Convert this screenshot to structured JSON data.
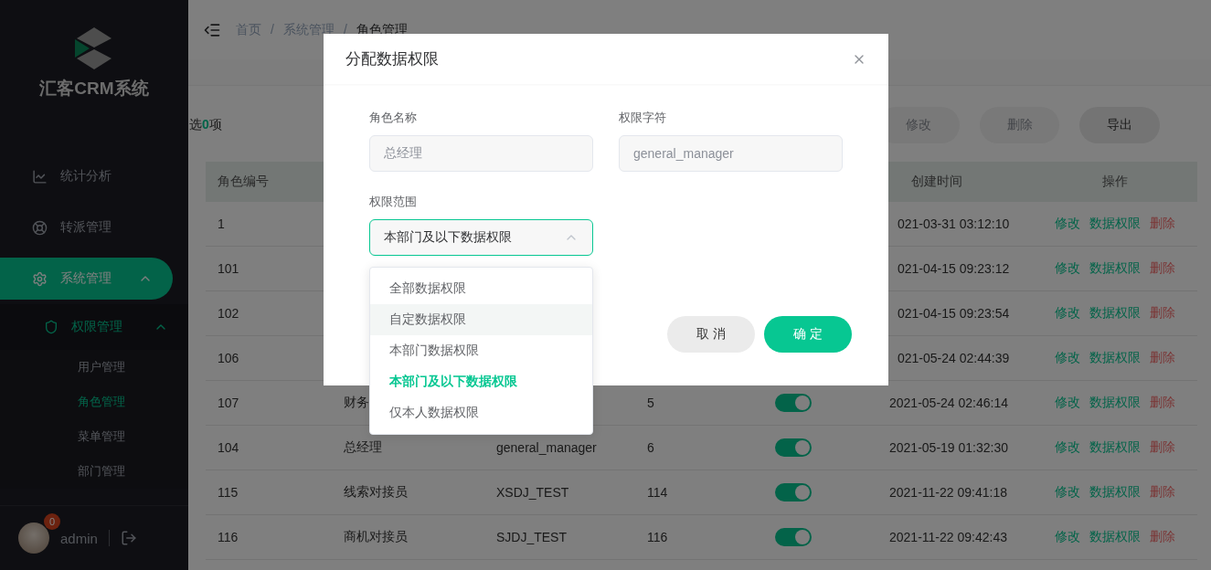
{
  "sidebar": {
    "brand": "汇客CRM系统",
    "menu": [
      {
        "label": "统计分析",
        "selected": false
      },
      {
        "label": "转派管理",
        "selected": false
      },
      {
        "label": "系统管理",
        "selected": true,
        "expanded": true,
        "children": [
          {
            "label": "权限管理",
            "selected": true,
            "expanded": true,
            "children": [
              {
                "label": "用户管理",
                "selected": false
              },
              {
                "label": "角色管理",
                "selected": true
              },
              {
                "label": "菜单管理",
                "selected": false
              },
              {
                "label": "部门管理",
                "selected": false
              }
            ]
          }
        ]
      }
    ],
    "user": {
      "name": "admin",
      "badge": "0"
    }
  },
  "breadcrumb": {
    "separator": "/",
    "items": [
      "首页",
      "系统管理",
      "角色管理"
    ]
  },
  "toolbar": {
    "selection": "选**0**项",
    "buttons": [
      {
        "label": "修改",
        "disabled": true
      },
      {
        "label": "删除",
        "disabled": true
      },
      {
        "label": "导出",
        "disabled": false
      }
    ]
  },
  "table": {
    "columns": {
      "column_1": "角色编号",
      "column_6": "创建时间",
      "column_7": "操作"
    },
    "rows": [
      {
        "id": "1",
        "created": "021-03-31 03:12:10",
        "actions": [
          {
            "label": "修改",
            "kind": "edit"
          },
          {
            "label": "数据权限",
            "kind": "scope"
          },
          {
            "label": "删除",
            "kind": "delete"
          }
        ]
      },
      {
        "id": "101",
        "created": "021-04-15 09:23:12",
        "actions": [
          {
            "label": "修改",
            "kind": "edit"
          },
          {
            "label": "数据权限",
            "kind": "scope"
          },
          {
            "label": "删除",
            "kind": "delete"
          }
        ]
      },
      {
        "id": "102",
        "created": "021-04-15 09:23:54",
        "actions": [
          {
            "label": "修改",
            "kind": "edit"
          },
          {
            "label": "数据权限",
            "kind": "scope"
          },
          {
            "label": "删除",
            "kind": "delete"
          }
        ]
      },
      {
        "id": "106",
        "created": "021-05-24 02:44:39",
        "actions": [
          {
            "label": "修改",
            "kind": "edit"
          },
          {
            "label": "数据权限",
            "kind": "scope"
          },
          {
            "label": "删除",
            "kind": "delete"
          }
        ]
      },
      {
        "id": "107",
        "name": "财务",
        "sort": "5",
        "on": true,
        "created": "2021-05-24 02:46:14",
        "actions": [
          {
            "label": "修改",
            "kind": "edit"
          },
          {
            "label": "数据权限",
            "kind": "scope"
          },
          {
            "label": "删除",
            "kind": "delete"
          }
        ]
      },
      {
        "id": "104",
        "name": "总经理",
        "code": "general_manager",
        "sort": "6",
        "on": true,
        "created": "2021-05-19 01:32:30",
        "actions": [
          {
            "label": "修改",
            "kind": "edit"
          },
          {
            "label": "数据权限",
            "kind": "scope"
          },
          {
            "label": "删除",
            "kind": "delete"
          }
        ]
      },
      {
        "id": "115",
        "name": "线索对接员",
        "code": "XSDJ_TEST",
        "sort": "114",
        "on": true,
        "created": "2021-11-22 09:41:18",
        "actions": [
          {
            "label": "修改",
            "kind": "edit"
          },
          {
            "label": "数据权限",
            "kind": "scope"
          },
          {
            "label": "删除",
            "kind": "delete"
          }
        ]
      },
      {
        "id": "116",
        "name": "商机对接员",
        "code": "SJDJ_TEST",
        "sort": "116",
        "on": true,
        "created": "2021-11-22 09:42:43",
        "actions": [
          {
            "label": "修改",
            "kind": "edit"
          },
          {
            "label": "数据权限",
            "kind": "scope"
          },
          {
            "label": "删除",
            "kind": "delete"
          }
        ]
      }
    ]
  },
  "dialog": {
    "title": "分配数据权限",
    "fields": [
      {
        "label": "角色名称",
        "value": "总经理"
      },
      {
        "label": "权限字符",
        "value": "general_manager"
      }
    ],
    "scope": {
      "label": "权限范围",
      "value": "本部门及以下数据权限",
      "expanded": true,
      "options": [
        {
          "label": "全部数据权限",
          "selected": false,
          "hovered": false
        },
        {
          "label": "自定数据权限",
          "selected": false,
          "hovered": true
        },
        {
          "label": "本部门数据权限",
          "selected": false,
          "hovered": false
        },
        {
          "label": "本部门及以下数据权限",
          "selected": true,
          "hovered": false
        },
        {
          "label": "仅本人数据权限",
          "selected": false,
          "hovered": false
        }
      ]
    },
    "buttons": [
      {
        "label": "取 消",
        "kind": "cancel"
      },
      {
        "label": "确 定",
        "kind": "primary"
      }
    ]
  }
}
